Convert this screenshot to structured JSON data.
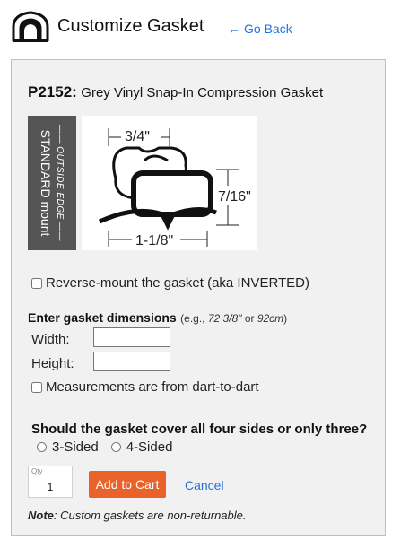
{
  "header": {
    "title": "Customize Gasket",
    "back_label": "Go Back",
    "back_icon": "arrow-left-icon",
    "logo_icon": "gasket-logo-icon"
  },
  "product": {
    "code": "P2152:",
    "name": "Grey Vinyl Snap-In Compression Gasket"
  },
  "diagram": {
    "outside_edge": "—— OUTSIDE EDGE ——",
    "mount_label": "STANDARD mount",
    "dim_top": "3/4\"",
    "dim_right": "7/16\"",
    "dim_bottom": "1-1/8\""
  },
  "reverse_mount": {
    "label": "Reverse-mount the gasket (aka INVERTED)",
    "checked": false
  },
  "dimensions": {
    "heading": "Enter gasket dimensions",
    "hint_prefix": "(e.g., ",
    "hint_example_1": "72 3/8\"",
    "hint_or": " or ",
    "hint_example_2": "92cm",
    "hint_suffix": ")",
    "width_label": "Width:",
    "width_value": "",
    "height_label": "Height:",
    "height_value": "",
    "dart_label": "Measurements are from dart-to-dart",
    "dart_checked": false
  },
  "sides": {
    "question": "Should the gasket cover all four sides or only three?",
    "option_3": "3-Sided",
    "option_4": "4-Sided"
  },
  "cart": {
    "qty_label": "Qty",
    "qty_value": "1",
    "add_label": "Add to Cart",
    "cancel_label": "Cancel"
  },
  "note": {
    "bold": "Note",
    "text": ": Custom gaskets are non-returnable."
  },
  "colors": {
    "accent_button": "#e8622a",
    "link": "#1a73e8",
    "panel_bg": "#f1f1f1",
    "mount_strip": "#555555"
  }
}
